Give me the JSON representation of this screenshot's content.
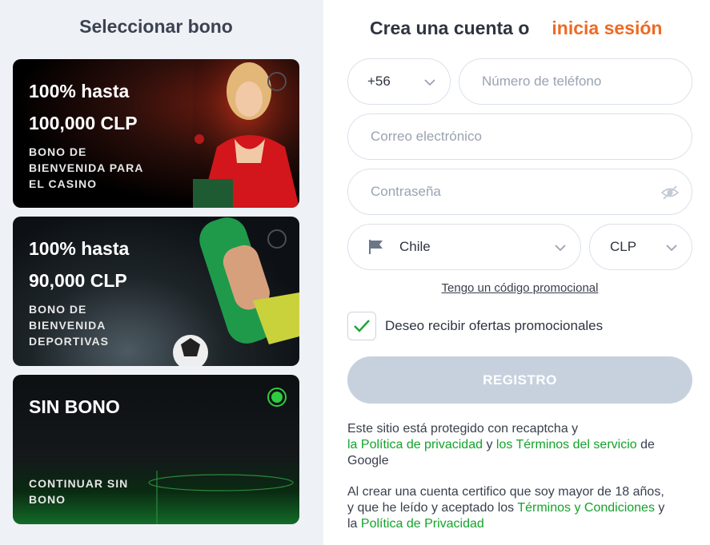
{
  "left": {
    "title": "Seleccionar bono",
    "cards": [
      {
        "line1": "100% hasta",
        "line2": "100,000 CLP",
        "sub1": "BONO DE",
        "sub2": "BIENVENIDA PARA",
        "sub3": "EL CASINO",
        "selected": false
      },
      {
        "line1": "100% hasta",
        "line2": "90,000 CLP",
        "sub1": "BONO DE",
        "sub2": "BIENVENIDA",
        "sub3": "DEPORTIVAS",
        "selected": false
      },
      {
        "line1": "SIN BONO",
        "sub1": "CONTINUAR SIN",
        "sub2": "BONO",
        "selected": true
      }
    ]
  },
  "right": {
    "title": "Crea una cuenta o",
    "login_link": "inicia sesión",
    "phone_code": "+56",
    "phone_placeholder": "Número de teléfono",
    "email_placeholder": "Correo electrónico",
    "password_placeholder": "Contraseña",
    "country": "Chile",
    "currency": "CLP",
    "promo_link": "Tengo un código promocional",
    "offers_label": "Deseo recibir ofertas promocionales",
    "offers_checked": true,
    "register_button": "REGISTRO",
    "recaptcha": {
      "line1": "Este sitio está protegido con recaptcha y",
      "privacy_link": "la Política de privacidad",
      "and": "y",
      "terms_link": "los Términos del servicio",
      "de": "de",
      "google": "Google"
    },
    "age": {
      "line1": "Al crear una cuenta certifico que soy mayor de 18 años,",
      "line2_pre": "y que he leído y aceptado los",
      "terms_link": "Términos y Condiciones",
      "y": "y",
      "line3_pre": "la",
      "privacy_link": "Política de Privacidad"
    }
  },
  "colors": {
    "accent_orange": "#ee6a24",
    "link_green": "#14a32b",
    "selected_green": "#2ecc40",
    "button_disabled": "#c7d1de"
  },
  "icons": [
    "chevron-down-icon",
    "eye-off-icon",
    "flag-icon",
    "checkmark-icon"
  ]
}
